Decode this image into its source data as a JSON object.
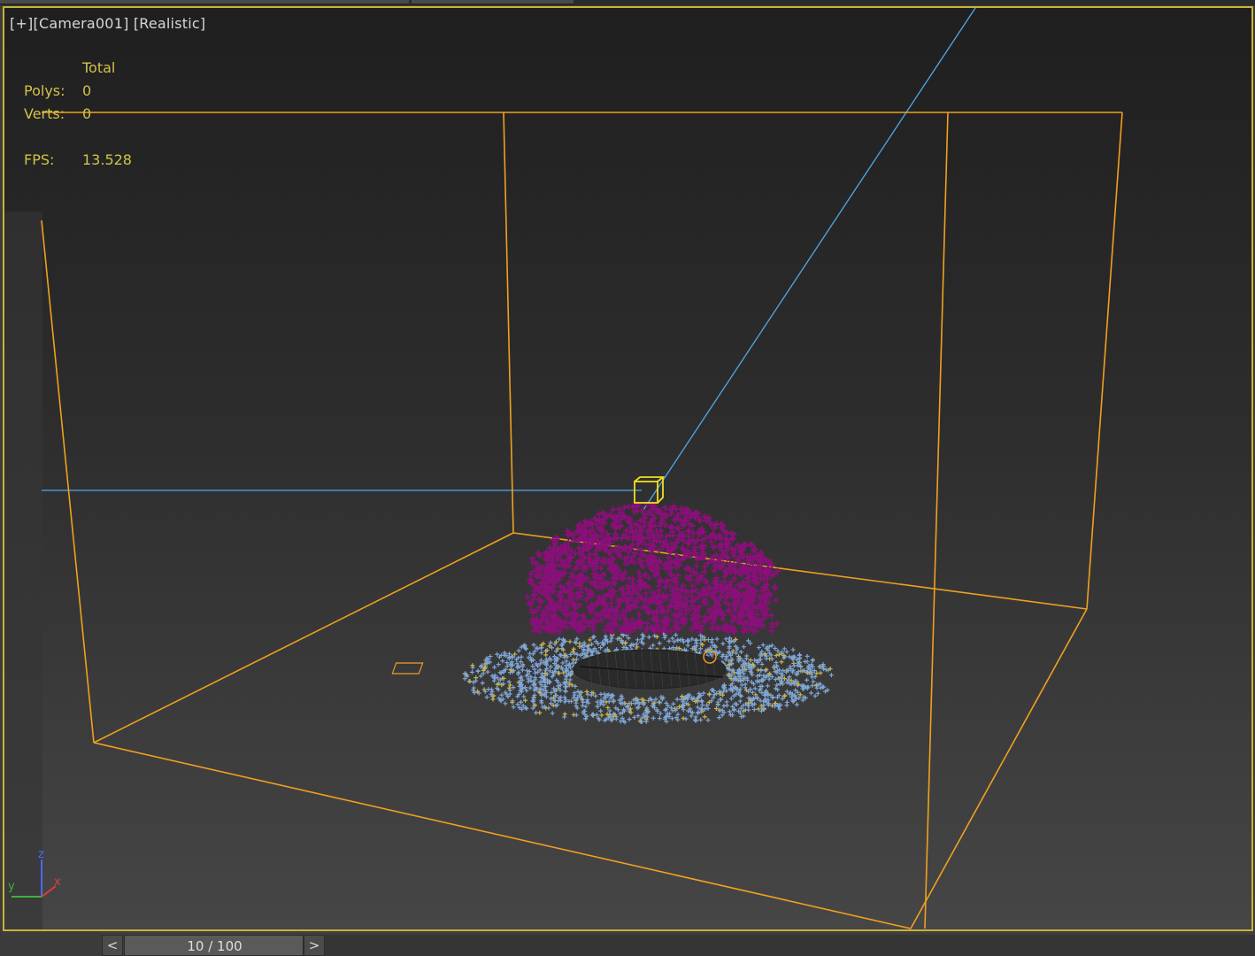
{
  "viewport": {
    "label_plus": "[+]",
    "label_camera": "[Camera001]",
    "label_shading": "[Realistic]",
    "border_color": "#c9b338",
    "stats": {
      "header": "Total",
      "polys_label": "Polys:",
      "polys_value": "0",
      "verts_label": "Verts:",
      "verts_value": "0",
      "fps_label": "FPS:",
      "fps_value": "13.528",
      "color": "#d2c24a"
    },
    "axis_gizmo": {
      "z_label": "z",
      "y_label": "y",
      "x_label": "x",
      "z_color": "#4a6bff",
      "y_color": "#3fae3f",
      "x_color": "#e03b3b"
    },
    "scene": {
      "bounding_box_color": "#f0a020",
      "laser_line_color": "#4fa8e8",
      "particles_upper_color": "#8b0f7a",
      "particles_lower_color": "#7fa6d6",
      "icon_helper": "emitter-icon",
      "small_box_color": "#f0e020"
    }
  },
  "timeline": {
    "prev_label": "<",
    "next_label": ">",
    "frame_display": "10 / 100",
    "current_frame": 10,
    "total_frames": 100
  }
}
